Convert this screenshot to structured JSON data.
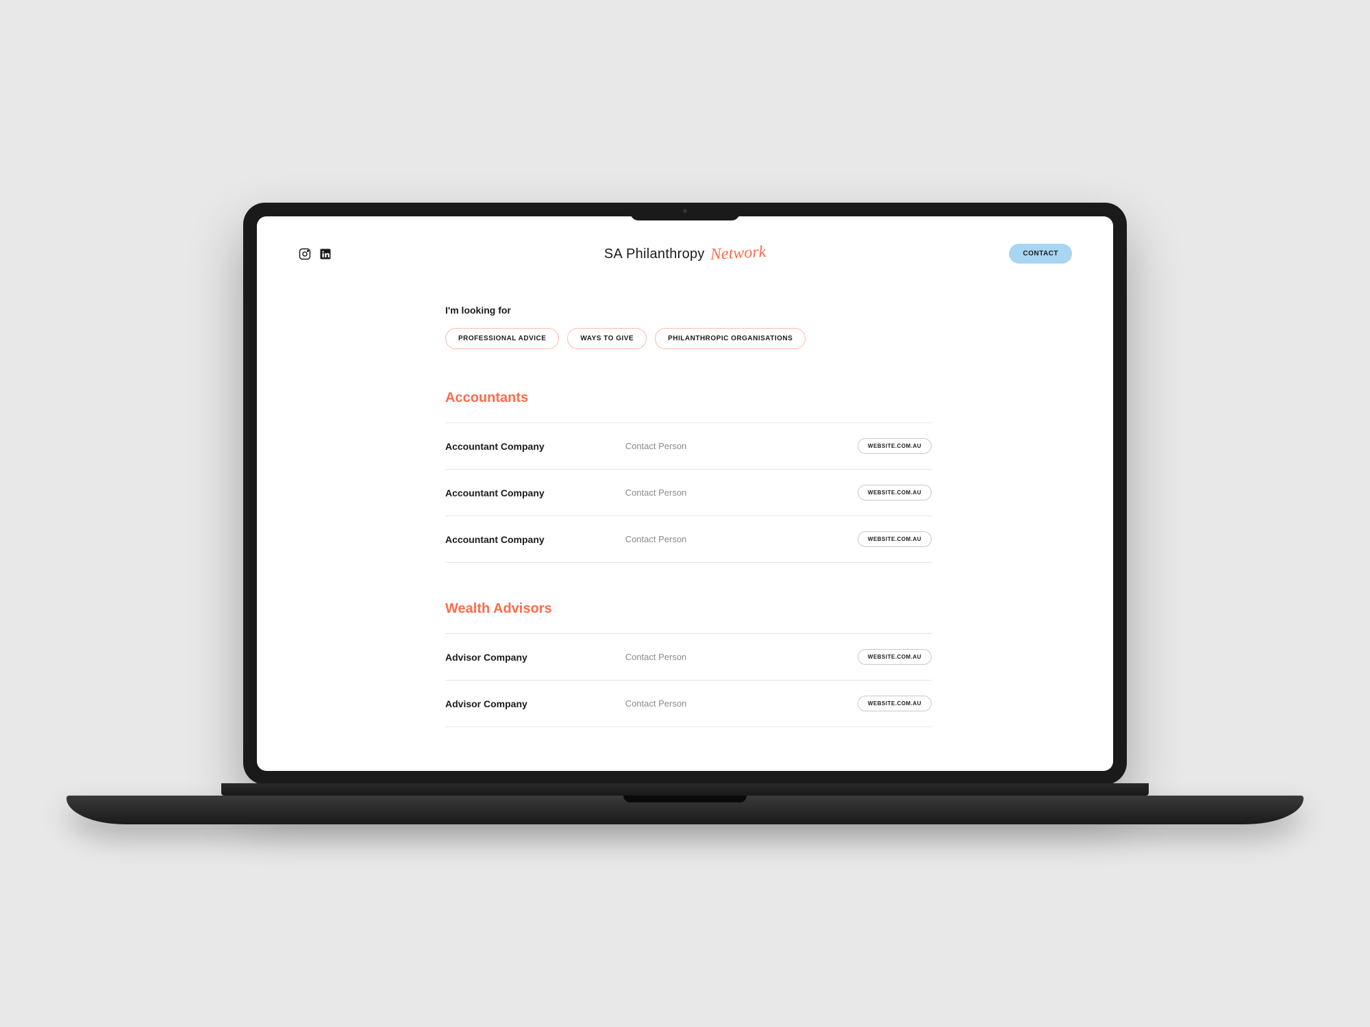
{
  "header": {
    "logo_main": "SA Philanthropy",
    "logo_script": "Network",
    "contact_label": "CONTACT"
  },
  "filter": {
    "label": "I'm looking for",
    "options": [
      "PROFESSIONAL ADVICE",
      "WAYS TO GIVE",
      "PHILANTHROPIC ORGANISATIONS"
    ]
  },
  "sections": [
    {
      "title": "Accountants",
      "rows": [
        {
          "company": "Accountant Company",
          "contact": "Contact Person",
          "website": "WEBSITE.COM.AU"
        },
        {
          "company": "Accountant Company",
          "contact": "Contact Person",
          "website": "WEBSITE.COM.AU"
        },
        {
          "company": "Accountant Company",
          "contact": "Contact Person",
          "website": "WEBSITE.COM.AU"
        }
      ]
    },
    {
      "title": "Wealth Advisors",
      "rows": [
        {
          "company": "Advisor Company",
          "contact": "Contact Person",
          "website": "WEBSITE.COM.AU"
        },
        {
          "company": "Advisor Company",
          "contact": "Contact Person",
          "website": "WEBSITE.COM.AU"
        }
      ]
    }
  ]
}
